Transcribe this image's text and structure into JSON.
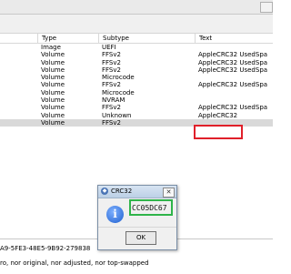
{
  "table": {
    "headers": [
      "Type",
      "Subtype",
      "Text"
    ],
    "rows": [
      {
        "type": "Image",
        "subtype": "UEFI",
        "text": ""
      },
      {
        "type": "Volume",
        "subtype": "FFSv2",
        "text": "AppleCRC32 UsedSpa"
      },
      {
        "type": "Volume",
        "subtype": "FFSv2",
        "text": "AppleCRC32 UsedSpa"
      },
      {
        "type": "Volume",
        "subtype": "FFSv2",
        "text": "AppleCRC32 UsedSpa"
      },
      {
        "type": "Volume",
        "subtype": "Microcode",
        "text": ""
      },
      {
        "type": "Volume",
        "subtype": "FFSv2",
        "text": "AppleCRC32 UsedSpa"
      },
      {
        "type": "Volume",
        "subtype": "Microcode",
        "text": ""
      },
      {
        "type": "Volume",
        "subtype": "NVRAM",
        "text": ""
      },
      {
        "type": "Volume",
        "subtype": "FFSv2",
        "text": "AppleCRC32 UsedSpa"
      },
      {
        "type": "Volume",
        "subtype": "Unknown",
        "text": "AppleCRC32"
      },
      {
        "type": "Volume",
        "subtype": "FFSv2",
        "text": ""
      }
    ]
  },
  "bottom_panel": {
    "line1": "A9-5FE3-48E5-9B92-279838",
    "line2": "ro, nor original, nor adjusted, nor top-swapped"
  },
  "dialog": {
    "title": "CRC32",
    "value": "CC05DC67",
    "ok_label": "OK",
    "close_glyph": "✕",
    "info_glyph": "i"
  },
  "colors": {
    "highlight_red": "#e0202a",
    "highlight_green": "#2fb44a",
    "selected_row": "#d9d9d9"
  }
}
